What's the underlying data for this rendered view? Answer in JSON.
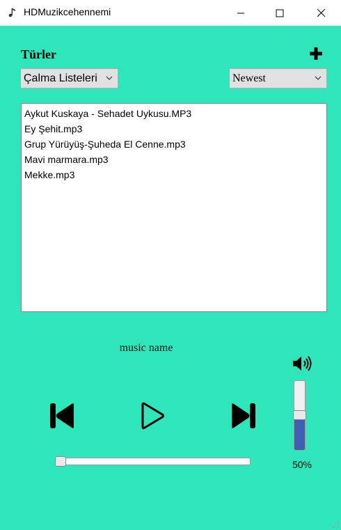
{
  "window": {
    "title": "HDMuzikcehennemi",
    "icon": "music-note-icon",
    "controls": [
      "minimize-icon",
      "maximize-icon",
      "close-icon"
    ]
  },
  "header": {
    "heading": "Türler",
    "add_icon": "plus-icon"
  },
  "filters": {
    "category_selected": "Çalma Listeleri",
    "sort_selected": "Newest"
  },
  "tracks": [
    "Aykut Kuskaya - Sehadet Uykusu.MP3",
    "Ey Şehit.mp3",
    "Grup Yürüyüş-Şuheda El Cenne.mp3",
    "Mavi marmara.mp3",
    "Mekke.mp3"
  ],
  "player": {
    "track_label": "music name",
    "seek_fraction": 0,
    "buttons": [
      "skip-previous-icon",
      "play-icon",
      "skip-next-icon"
    ]
  },
  "volume": {
    "icon": "speaker-icon",
    "level": 0.5,
    "label": "50%"
  },
  "colors": {
    "background": "#2ee6ba",
    "volume_fill": "#3d5fb4"
  }
}
